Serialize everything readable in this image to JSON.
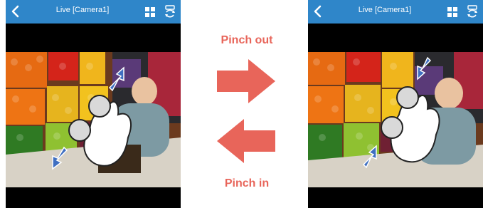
{
  "screens": [
    {
      "id": "left",
      "title": "Live [Camera1]",
      "back_icon": "chevron-left-icon",
      "layout_icon": "grid-icon",
      "switch_icon": "camera-switch-icon",
      "gesture": "pinch-out"
    },
    {
      "id": "right",
      "title": "Live [Camera1]",
      "back_icon": "chevron-left-icon",
      "layout_icon": "grid-icon",
      "switch_icon": "camera-switch-icon",
      "gesture": "pinch-in"
    }
  ],
  "instructions": {
    "pinch_out": "Pinch out",
    "pinch_in": "Pinch in"
  },
  "colors": {
    "topbar": "#2f86c9",
    "arrow": "#e8655a",
    "finger_arrow": "#3f6fc1"
  }
}
